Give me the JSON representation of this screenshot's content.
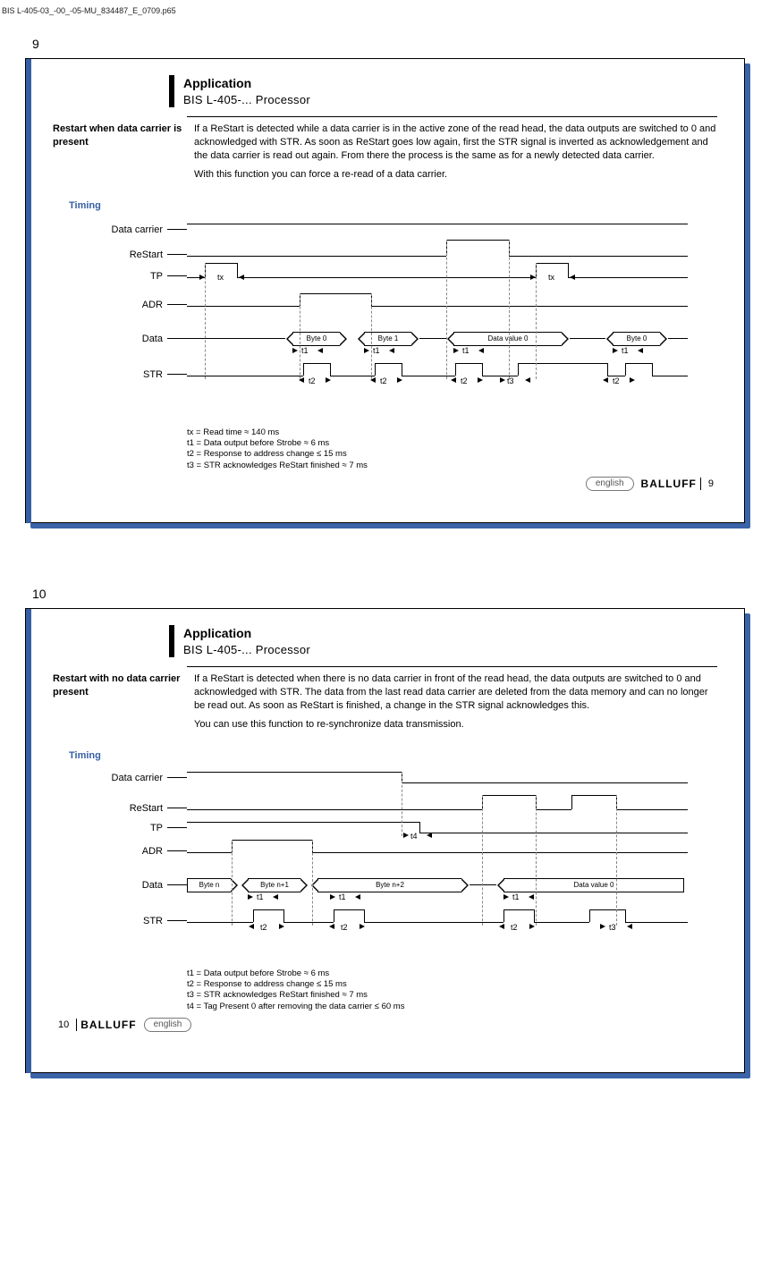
{
  "file_header": "BIS L-405-03_-00_-05-MU_834487_E_0709.p65",
  "pages": [
    {
      "num": "9",
      "title": "Application",
      "subtitle": "BIS L-405-...  Processor",
      "section_label": "Restart when data carrier is present",
      "body_p1": "If a ReStart is detected while a data carrier is in the active zone of the read head, the data outputs are switched to 0 and acknowledged with STR. As soon as ReStart goes low again, first the STR signal is inverted as acknowledgement and the data carrier is read out again. From there the process is the same as for a newly detected data carrier.",
      "body_p2": "With this function you can force a re-read of a data carrier.",
      "timing_label": "Timing",
      "signals": [
        "Data carrier",
        "ReStart",
        "TP",
        "ADR",
        "Data",
        "STR"
      ],
      "tx": "tx",
      "t1": "t1",
      "t2": "t2",
      "t3": "t3",
      "data_labels": [
        "Byte 0",
        "Byte 1",
        "Data value 0",
        "Byte 0"
      ],
      "notes": [
        "tx = Read time ≈ 140 ms",
        "t1 = Data output before Strobe ≈ 6 ms",
        "t2 = Response to address change ≤ 15 ms",
        "t3 = STR acknowledges ReStart finished ≈ 7 ms"
      ],
      "lang": "english",
      "brand": "BALLUFF",
      "foot_num": "9"
    },
    {
      "num": "10",
      "title": "Application",
      "subtitle": "BIS L-405-...  Processor",
      "section_label": "Restart with no data carrier present",
      "body_p1": "If a ReStart is detected when there is no data carrier in front of the read head, the data outputs are switched to 0 and acknowledged with STR. The data from the last read data carrier are deleted from the data memory and can no longer be read out. As soon as ReStart is finished, a change in the STR signal acknowledges this.",
      "body_p2": "You can use this function to re-synchronize data transmission.",
      "timing_label": "Timing",
      "signals": [
        "Data carrier",
        "ReStart",
        "TP",
        "ADR",
        "Data",
        "STR"
      ],
      "t1": "t1",
      "t2": "t2",
      "t3": "t3",
      "t4": "t4",
      "data_labels": [
        "Byte n",
        "Byte n+1",
        "Byte n+2",
        "Data value 0"
      ],
      "notes": [
        "t1 = Data output before Strobe ≈ 6 ms",
        "t2 = Response to address change ≤ 15 ms",
        "t3 = STR acknowledges ReStart finished ≈ 7 ms",
        "t4 = Tag Present 0 after removing the data carrier ≤ 60 ms"
      ],
      "lang": "english",
      "brand": "BALLUFF",
      "foot_num": "10"
    }
  ]
}
